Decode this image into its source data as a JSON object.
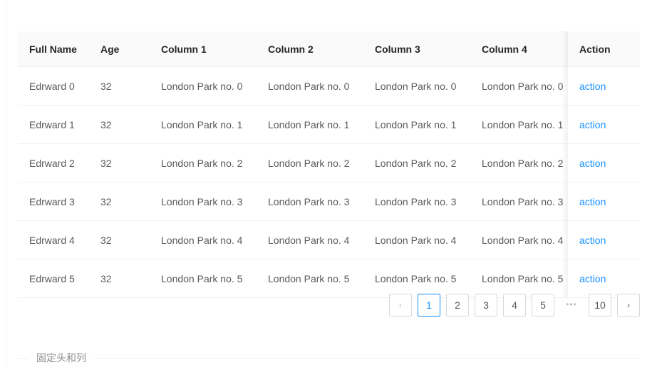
{
  "table": {
    "columns": [
      {
        "key": "name",
        "label": "Full Name"
      },
      {
        "key": "age",
        "label": "Age"
      },
      {
        "key": "col1",
        "label": "Column 1"
      },
      {
        "key": "col2",
        "label": "Column 2"
      },
      {
        "key": "col3",
        "label": "Column 3"
      },
      {
        "key": "col4",
        "label": "Column 4"
      },
      {
        "key": "action",
        "label": "Action"
      }
    ],
    "rows": [
      {
        "name": "Edrward 0",
        "age": "32",
        "col1": "London Park no. 0",
        "col2": "London Park no. 0",
        "col3": "London Park no. 0",
        "col4": "London Park no. 0",
        "action": "action"
      },
      {
        "name": "Edrward 1",
        "age": "32",
        "col1": "London Park no. 1",
        "col2": "London Park no. 1",
        "col3": "London Park no. 1",
        "col4": "London Park no. 1",
        "action": "action"
      },
      {
        "name": "Edrward 2",
        "age": "32",
        "col1": "London Park no. 2",
        "col2": "London Park no. 2",
        "col3": "London Park no. 2",
        "col4": "London Park no. 2",
        "action": "action"
      },
      {
        "name": "Edrward 3",
        "age": "32",
        "col1": "London Park no. 3",
        "col2": "London Park no. 3",
        "col3": "London Park no. 3",
        "col4": "London Park no. 3",
        "action": "action"
      },
      {
        "name": "Edrward 4",
        "age": "32",
        "col1": "London Park no. 4",
        "col2": "London Park no. 4",
        "col3": "London Park no. 4",
        "col4": "London Park no. 4",
        "action": "action"
      },
      {
        "name": "Edrward 5",
        "age": "32",
        "col1": "London Park no. 5",
        "col2": "London Park no. 5",
        "col3": "London Park no. 5",
        "col4": "London Park no. 5",
        "action": "action"
      }
    ]
  },
  "pagination": {
    "prev_icon": "chevron-left",
    "next_icon": "chevron-right",
    "ellipsis": "•••",
    "pages": [
      "1",
      "2",
      "3",
      "4",
      "5"
    ],
    "last_page": "10",
    "active_page": "1"
  },
  "caption": {
    "text": "固定头和列"
  },
  "colors": {
    "accent": "#1890ff",
    "header_bg": "#fafafa",
    "border": "#f0f0f0",
    "text": "#595959",
    "heading_text": "#262626",
    "muted": "#bfbfbf"
  }
}
